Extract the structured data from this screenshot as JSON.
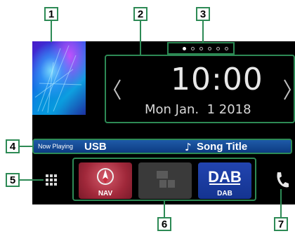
{
  "callouts": [
    "1",
    "2",
    "3",
    "4",
    "5",
    "6",
    "7"
  ],
  "clock": {
    "time": "10:00",
    "date": "Mon Jan.  1 2018"
  },
  "page_dots": {
    "count": 6,
    "active": 1
  },
  "now_playing": {
    "prefix": "Now Playing",
    "source": "USB",
    "note": "♪",
    "title": "Song Title"
  },
  "launcher": [
    {
      "label": "NAV",
      "icon": "navigation-icon"
    },
    {
      "label": "",
      "icon": "blank-app-icon"
    },
    {
      "label": "DAB",
      "icon": "dab-logo-icon",
      "logo_text": "DAB"
    }
  ],
  "colors": {
    "callout_border": "#2d8a55",
    "now_playing_bar": "#1a4f9c",
    "nav_tile": "#a0283a",
    "dab_tile": "#1a3fa0"
  }
}
